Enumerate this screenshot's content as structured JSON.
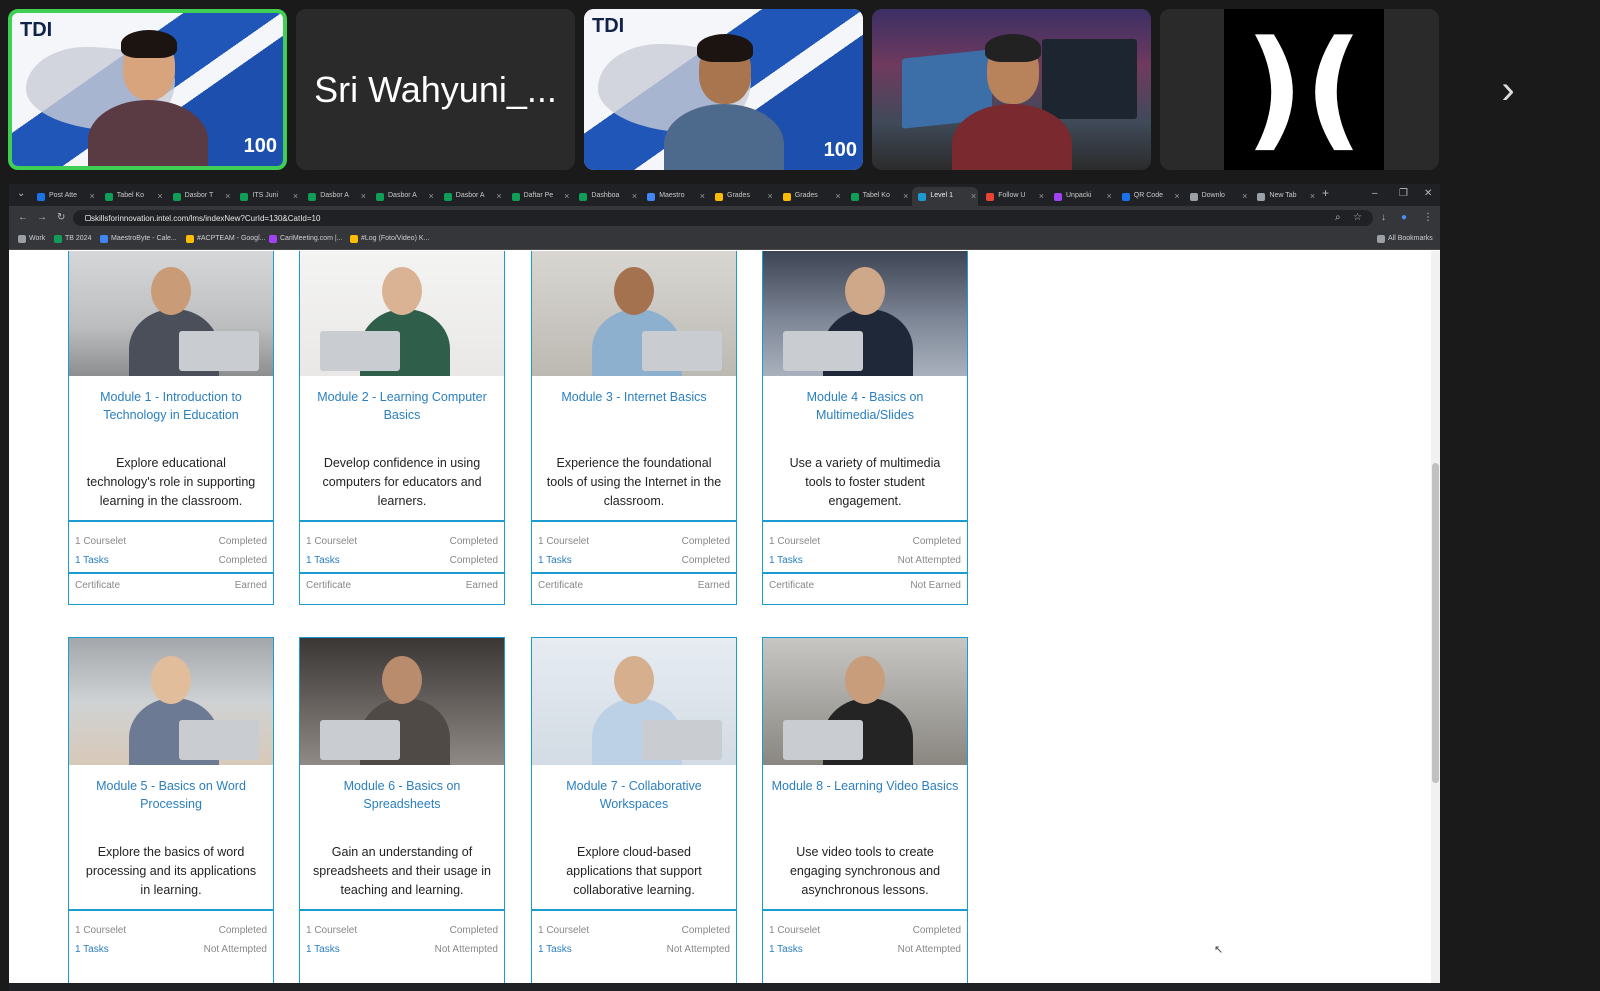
{
  "participants": [
    {
      "type": "video",
      "logo": "TDI",
      "badge": "100",
      "active": true
    },
    {
      "type": "name",
      "name": "Sri Wahyuni_..."
    },
    {
      "type": "video",
      "logo": "TDI",
      "badge": "100",
      "active": false
    },
    {
      "type": "video",
      "logo": "",
      "badge": "",
      "active": false
    },
    {
      "type": "logo",
      "logo": "",
      "badge": "",
      "active": false
    }
  ],
  "strip_next_icon": "chevron-right-icon",
  "browser": {
    "tabs": [
      {
        "label": "Post Atte",
        "color": "#1a73e8"
      },
      {
        "label": "Tabel Ko",
        "color": "#0f9d58"
      },
      {
        "label": "Dasbor T",
        "color": "#0f9d58"
      },
      {
        "label": "ITS Juni",
        "color": "#0f9d58"
      },
      {
        "label": "Dasbor A",
        "color": "#0f9d58"
      },
      {
        "label": "Dasbor A",
        "color": "#0f9d58"
      },
      {
        "label": "Dasbor A",
        "color": "#0f9d58"
      },
      {
        "label": "Daftar Pe",
        "color": "#0f9d58"
      },
      {
        "label": "Dashboa",
        "color": "#0f9d58"
      },
      {
        "label": "Maestro",
        "color": "#4285f4"
      },
      {
        "label": "Grades",
        "color": "#fbbc04"
      },
      {
        "label": "Grades",
        "color": "#fbbc04"
      },
      {
        "label": "Tabel Ko",
        "color": "#0f9d58"
      },
      {
        "label": "Level 1",
        "color": "#1c9bd0",
        "active": true
      },
      {
        "label": "Follow U",
        "color": "#ea4335"
      },
      {
        "label": "Unpacki",
        "color": "#a142f4"
      },
      {
        "label": "QR Code",
        "color": "#1a73e8"
      },
      {
        "label": "Downlo",
        "color": "#9aa0a6"
      },
      {
        "label": "New Tab",
        "color": "#9aa0a6"
      }
    ],
    "url": "skillsforinnovation.intel.com/lms/indexNew?CurId=130&CatId=10",
    "bookmarks": [
      {
        "label": "Work",
        "color": "#9aa0a6"
      },
      {
        "label": "TB 2024",
        "color": "#0f9d58"
      },
      {
        "label": "MaestroByte - Cale...",
        "color": "#4285f4"
      },
      {
        "label": "#ACPTEAM - Googl...",
        "color": "#fbbc04"
      },
      {
        "label": "CariMeeting.com |...",
        "color": "#a142f4"
      },
      {
        "label": "#Log (Foto/Video) K...",
        "color": "#fbbc04"
      }
    ],
    "all_bookmarks": "All Bookmarks"
  },
  "modules": [
    {
      "title": "Module 1 - Introduction to Technology in Education",
      "desc": "Explore educational technology's role in supporting learning in the classroom.",
      "courselet": "1 Courselet",
      "courselet_status": "Completed",
      "tasks": "1 Tasks",
      "tasks_status": "Completed",
      "cert": "Certificate",
      "cert_status": "Earned"
    },
    {
      "title": "Module 2 - Learning Computer Basics",
      "desc": "Develop confidence in using computers for educators and learners.",
      "courselet": "1 Courselet",
      "courselet_status": "Completed",
      "tasks": "1 Tasks",
      "tasks_status": "Completed",
      "cert": "Certificate",
      "cert_status": "Earned"
    },
    {
      "title": "Module 3 - Internet Basics",
      "desc": "Experience the foundational tools of using the Internet in the classroom.",
      "courselet": "1 Courselet",
      "courselet_status": "Completed",
      "tasks": "1 Tasks",
      "tasks_status": "Completed",
      "cert": "Certificate",
      "cert_status": "Earned"
    },
    {
      "title": "Module 4 - Basics on Multimedia/Slides",
      "desc": "Use a variety of multimedia tools to foster student engagement.",
      "courselet": "1 Courselet",
      "courselet_status": "Completed",
      "tasks": "1 Tasks",
      "tasks_status": "Not Attempted",
      "cert": "Certificate",
      "cert_status": "Not Earned"
    },
    {
      "title": "Module 5 - Basics on Word Processing",
      "desc": "Explore the basics of word processing and its applications in learning.",
      "courselet": "1 Courselet",
      "courselet_status": "Completed",
      "tasks": "1 Tasks",
      "tasks_status": "Not Attempted"
    },
    {
      "title": "Module 6 - Basics on Spreadsheets",
      "desc": "Gain an understanding of spreadsheets and their usage in teaching and learning.",
      "courselet": "1 Courselet",
      "courselet_status": "Completed",
      "tasks": "1 Tasks",
      "tasks_status": "Not Attempted"
    },
    {
      "title": "Module 7 - Collaborative Workspaces",
      "desc": "Explore cloud-based applications that support collaborative learning.",
      "courselet": "1 Courselet",
      "courselet_status": "Completed",
      "tasks": "1 Tasks",
      "tasks_status": "Not Attempted"
    },
    {
      "title": "Module 8 - Learning Video Basics",
      "desc": "Use video tools to create engaging synchronous and asynchronous lessons.",
      "courselet": "1 Courselet",
      "courselet_status": "Completed",
      "tasks": "1 Tasks",
      "tasks_status": "Not Attempted"
    }
  ],
  "colors": {
    "accent": "#1c9bd0",
    "link": "#2a7fc0",
    "active_speaker": "#3fcf55"
  }
}
